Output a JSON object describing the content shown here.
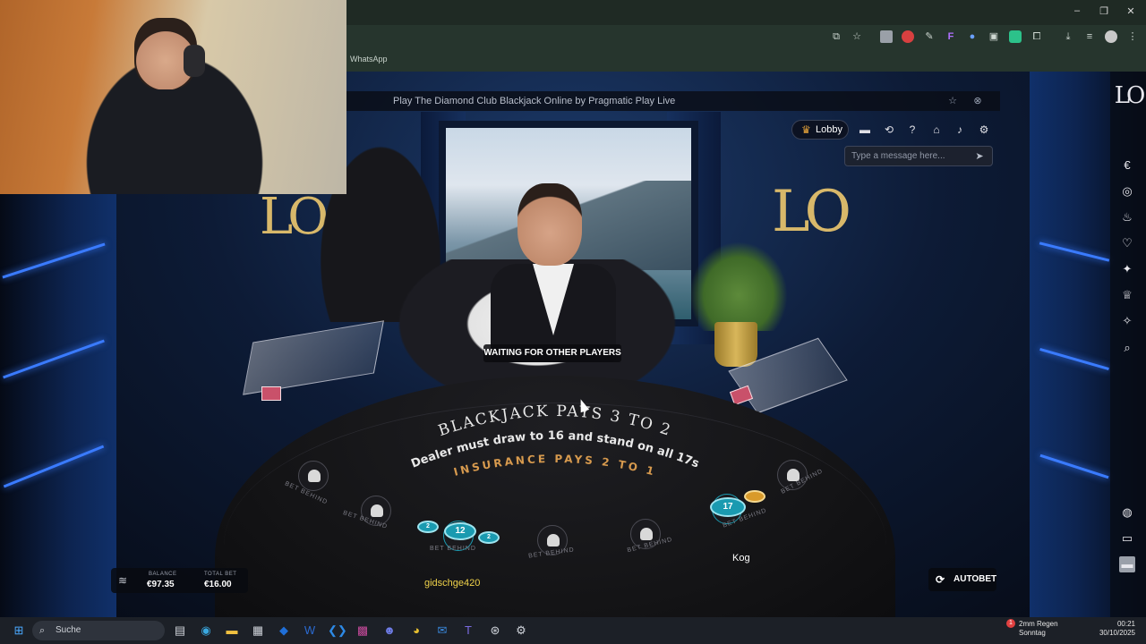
{
  "browser": {
    "bookmark": "WhatsApp",
    "window_controls": [
      "–",
      "❐",
      "✕"
    ]
  },
  "game": {
    "window_title": "Play The Diamond Club Blackjack Online by Pragmatic Play Live",
    "logo_text": "LO",
    "status_message": "WAITING FOR OTHER PLAYERS",
    "lobby_label": "Lobby",
    "chat_placeholder": "Type a message here...",
    "table_text": {
      "line1": "BLACKJACK PAYS 3 TO 2",
      "line2": "Dealer must draw to 16 and stand on all 17s",
      "line3": "INSURANCE PAYS 2 TO 1"
    },
    "seat_labels": {
      "bet_behind": "BET BEHIND",
      "pp": "PP",
      "side": "21+3"
    },
    "chips": {
      "seat3_total": "12",
      "seat7_total": "17"
    },
    "players": {
      "seat3": "gidschge420",
      "seat6": "Kog"
    },
    "balance": {
      "balance_label": "BALANCE",
      "balance_value": "€97.35",
      "total_bet_label": "TOTAL BET",
      "total_bet_value": "€16.00"
    },
    "autobet_label": "AUTOBET"
  },
  "side_menu": {
    "logo": "LO",
    "icons": [
      "euro-icon",
      "target-icon",
      "flame-icon",
      "heart-card-icon",
      "sparkle-icon",
      "trophy-icon",
      "magic-icon",
      "search-icon",
      "chat-icon",
      "bag-icon",
      "tablet-icon"
    ]
  },
  "taskbar": {
    "search_label": "Suche",
    "weather_line1": "2mm Regen",
    "weather_line2": "Sonntag",
    "time": "00:21",
    "date": "30/10/2025",
    "notification_badge": "1"
  },
  "colors": {
    "accent_gold": "#d79a4e",
    "chip_teal": "#1a9ab0",
    "neon_blue": "#3a7bff"
  }
}
